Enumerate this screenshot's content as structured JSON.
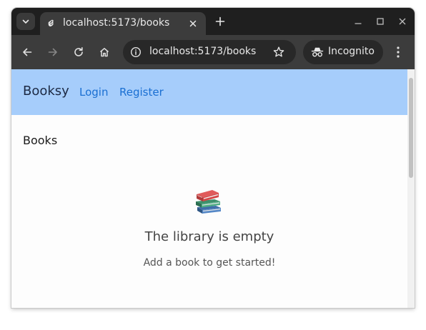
{
  "browser": {
    "tab": {
      "title": "localhost:5173/books"
    },
    "address_bar": {
      "url": "localhost:5173/books"
    },
    "profile": {
      "label": "Incognito"
    },
    "icons": {
      "tab_search": "chevron-down-icon",
      "favicon": "svelte-logo-icon",
      "tab_close": "close-icon",
      "new_tab": "plus-icon",
      "minimize": "minimize-icon",
      "maximize": "maximize-icon",
      "close_window": "close-icon",
      "back": "arrow-left-icon",
      "forward": "arrow-right-icon",
      "reload": "reload-icon",
      "home": "home-icon",
      "site_info": "info-icon",
      "bookmark": "star-icon",
      "incognito": "incognito-icon",
      "menu": "three-dots-vertical-icon"
    }
  },
  "app": {
    "navbar": {
      "brand": "Booksy",
      "links": [
        {
          "label": "Login"
        },
        {
          "label": "Register"
        }
      ],
      "background": "#a6cdfb",
      "link_color": "#1a6fd2"
    },
    "page": {
      "heading": "Books",
      "empty_state": {
        "icon": "books-stack-icon",
        "title": "The library is empty",
        "subtitle": "Add a book to get started!"
      }
    }
  }
}
